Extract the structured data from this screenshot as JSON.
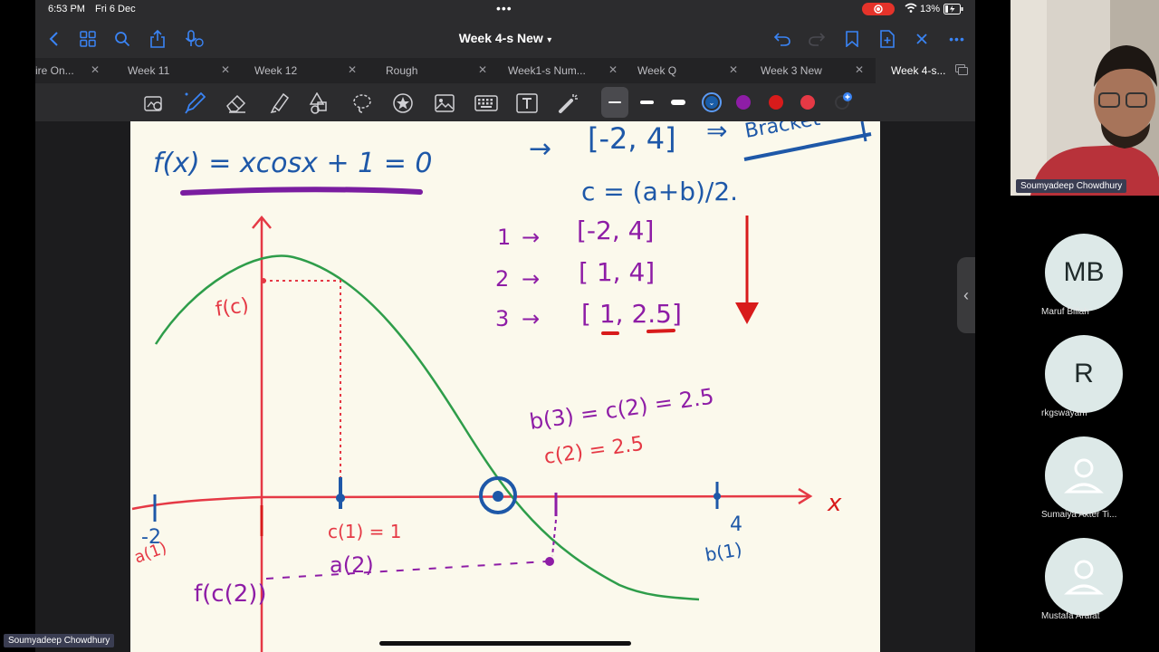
{
  "status": {
    "time": "6:53 PM",
    "date": "Fri 6 Dec",
    "battery": "13%"
  },
  "nav": {
    "doc_title": "Week 4-s New"
  },
  "tabs": [
    {
      "label": "ire On..."
    },
    {
      "label": "Week 11"
    },
    {
      "label": "Week 12"
    },
    {
      "label": "Rough"
    },
    {
      "label": "Week1-s Num..."
    },
    {
      "label": "Week Q"
    },
    {
      "label": "Week 3 New"
    },
    {
      "label": "Week 4-s..."
    }
  ],
  "toolbar": {
    "pen_colors": [
      "#1a5da8",
      "#8e1da6",
      "#d81b1b",
      "#e53945"
    ],
    "active_color": "#1a5da8"
  },
  "notes": {
    "equation": "f(x) = xcosx + 1 = 0",
    "arrow": "→",
    "bracket_init": "[-2, 4]",
    "bracket_word": "Bracket",
    "midpoint_formula": "c = (a+b)/2.",
    "iterations": [
      {
        "n": "1",
        "interval": "[-2, 4]"
      },
      {
        "n": "2",
        "interval": "[ 1, 4]"
      },
      {
        "n": "3",
        "interval": "[ 1, 2.5]"
      }
    ],
    "b3_eq": "b(3) = c(2) = 2.5",
    "c2_eq": "c(2) = 2.5",
    "x_axis_label": "x",
    "fc_label": "f(c)",
    "c1_label": "c(1) = 1",
    "a1_label": "a(1)",
    "neg2_label": "-2",
    "a2_label": "a(2)",
    "fc2_label": "f(c(2))",
    "four_label": "4",
    "b1_label": "b(1)"
  },
  "participants": {
    "host": "Soumyadeep Chowdhury",
    "list": [
      {
        "initials": "MB",
        "name": "Maruf Billah"
      },
      {
        "initials": "R",
        "name": "rkgswayam"
      },
      {
        "initials": "",
        "name": "Sumaiya Akter Ti..."
      },
      {
        "initials": "",
        "name": "Mustafa Arafat"
      }
    ],
    "self_label": "Soumyadeep Chowdhury"
  }
}
